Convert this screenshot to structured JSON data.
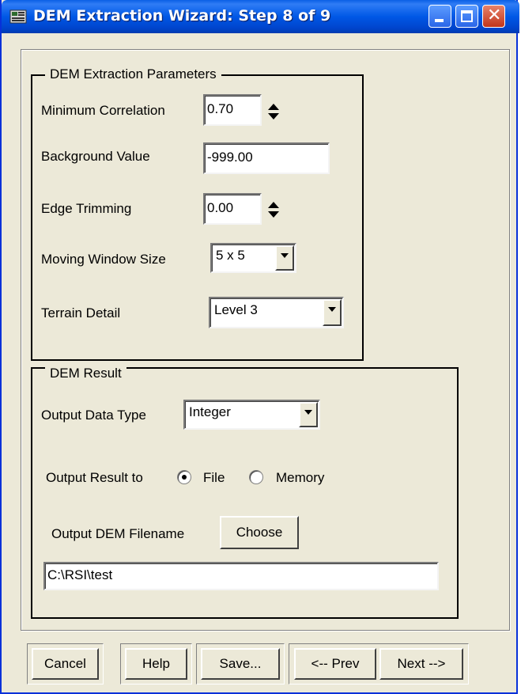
{
  "window": {
    "title": "DEM Extraction Wizard: Step 8 of 9"
  },
  "params": {
    "legend": "DEM Extraction Parameters",
    "min_corr_label": "Minimum Correlation",
    "min_corr_value": "0.70",
    "background_label": "Background Value",
    "background_value": "-999.00",
    "edge_label": "Edge Trimming",
    "edge_value": "0.00",
    "window_label": "Moving Window Size",
    "window_value": "5 x 5",
    "terrain_label": "Terrain Detail",
    "terrain_value": "Level 3"
  },
  "result": {
    "legend": "DEM Result",
    "dtype_label": "Output Data Type",
    "dtype_value": "Integer",
    "output_to_label": "Output Result to",
    "radio_file": "File",
    "radio_memory": "Memory",
    "selected_output": "File",
    "filename_label": "Output DEM Filename",
    "choose_label": "Choose",
    "filename_value": "C:\\RSI\\test"
  },
  "buttons": {
    "cancel": "Cancel",
    "help": "Help",
    "save": "Save...",
    "prev": "<-- Prev",
    "next": "Next -->"
  },
  "icons": {
    "app": "wizard-app-icon",
    "minimize": "minimize-icon",
    "maximize": "maximize-icon",
    "close": "close-icon",
    "spinner": "spinner-arrows-icon",
    "dropdown": "dropdown-arrow-icon"
  }
}
